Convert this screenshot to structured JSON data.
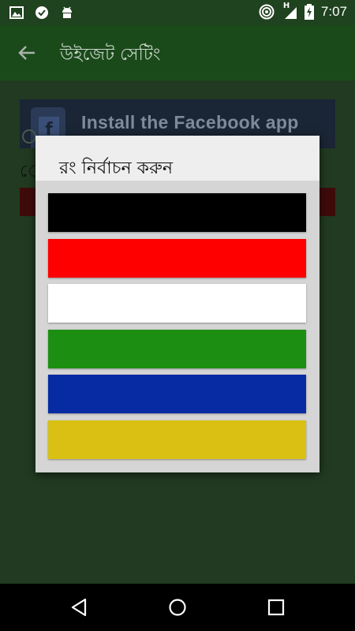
{
  "status_bar": {
    "time": "7:07",
    "network_label": "H",
    "left_icons": [
      "image-icon",
      "check-circle-icon",
      "android-icon"
    ],
    "right_icons": [
      "hotspot-icon",
      "signal-icon",
      "battery-icon"
    ]
  },
  "app_bar": {
    "title": "উইজেট সেটিং",
    "back_icon": "arrow-left-icon"
  },
  "content": {
    "ad_text": "Install the Facebook app",
    "partial_label": "ে"
  },
  "dialog": {
    "title": "রং নির্বাচন করুন",
    "colors": [
      "#000000",
      "#ff0000",
      "#ffffff",
      "#1c8f12",
      "#062ba3",
      "#d9c013"
    ]
  },
  "nav_bar": {
    "icons": [
      "back-triangle-icon",
      "home-circle-icon",
      "recents-square-icon"
    ]
  }
}
